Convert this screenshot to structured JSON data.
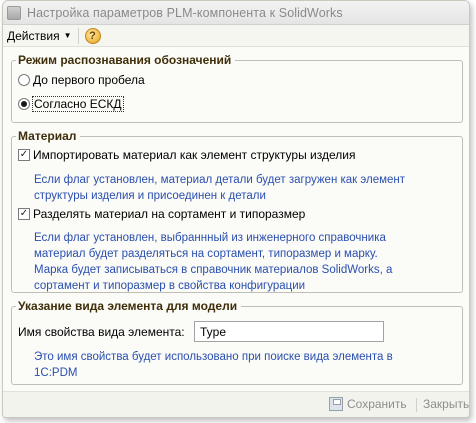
{
  "window": {
    "title": "Настройка параметров PLM-компонента к SolidWorks"
  },
  "toolbar": {
    "actions_label": "Действия",
    "help_label": "?"
  },
  "designation_group": {
    "title": "Режим распознавания обозначений",
    "options": [
      {
        "label": "До первого пробела",
        "selected": false
      },
      {
        "label": "Согласно ЕСКД",
        "selected": true
      }
    ]
  },
  "material_group": {
    "title": "Материал",
    "import_checkbox": {
      "label": "Импортировать материал как элемент структуры изделия",
      "checked": true
    },
    "import_hint_line1": "Если флаг установлен, материал детали будет загружен как элемент",
    "import_hint_line2": "структуры изделия и присоединен к детали",
    "split_checkbox": {
      "label": "Разделять материал на сортамент и типоразмер",
      "checked": true
    },
    "split_hint_line1": "Если флаг установлен, выбраннный из инженерного справочника",
    "split_hint_line2": "материал будет разделяться на сортамент, типоразмер и марку.",
    "split_hint_line3": "Марка будет записываться в справочник материалов SolidWorks, а",
    "split_hint_line4": "сортамент и типоразмер в свойства конфигурации"
  },
  "element_type_group": {
    "title": "Указание вида элемента для модели",
    "property_label": "Имя свойства вида элемента:",
    "property_value": "Type",
    "hint_line1": "Это имя свойства будет использовано при поиске вида элемента в",
    "hint_line2": "1C:PDM"
  },
  "buttons": {
    "save_label": "Сохранить",
    "close_label": "Закрыть"
  },
  "colors": {
    "hint_text": "#2a4fb0",
    "group_title": "#3f2e0a",
    "disabled_text": "#8d8d8d"
  }
}
